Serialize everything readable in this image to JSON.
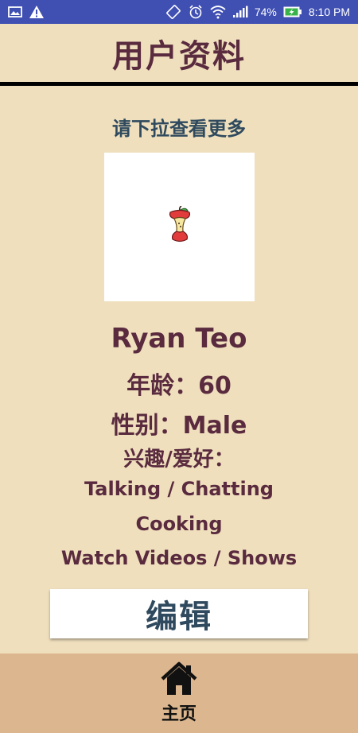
{
  "status_bar": {
    "battery": "74%",
    "time": "8:10 PM",
    "icons": [
      "image-icon",
      "warning-icon",
      "rotate-icon",
      "alarm-icon",
      "wifi-icon",
      "signal-icon",
      "battery-charging-icon"
    ]
  },
  "header": {
    "title": "用户资料"
  },
  "main": {
    "hint": "请下拉查看更多",
    "photo_icon": "apple-core-icon",
    "name": "Ryan Teo",
    "age": "年龄：60",
    "gender": "性别：Male",
    "hobby_label": "兴趣/爱好：",
    "hobbies": [
      "Talking / Chatting",
      "Cooking",
      "Watch Videos / Shows"
    ],
    "edit_label": "编辑"
  },
  "nav": {
    "home_label": "主页",
    "home_icon": "home-icon"
  },
  "colors": {
    "status_bar": "#3f4fb2",
    "background": "#efdfbd",
    "title_text": "#5a2b3e",
    "accent_text": "#2f4a5e",
    "nav_background": "#dcb68e"
  }
}
